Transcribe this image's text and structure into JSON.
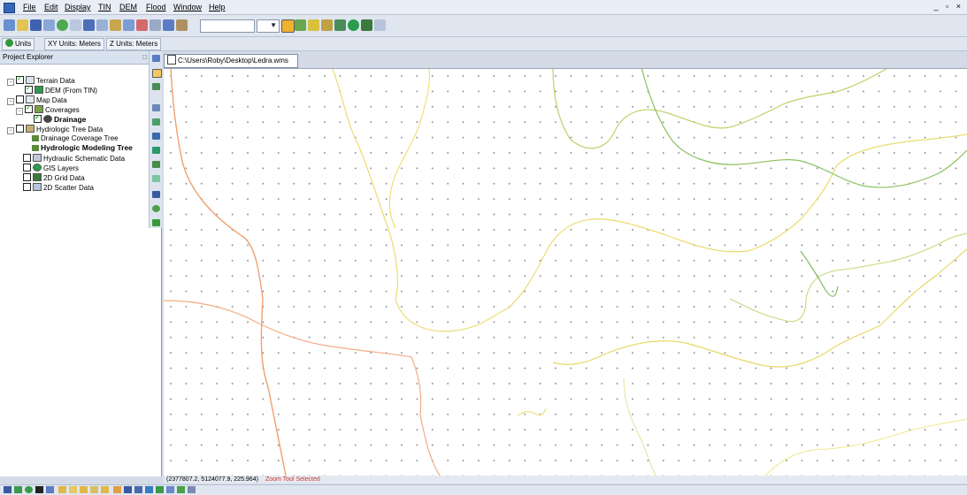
{
  "menu": {
    "items": [
      "File",
      "Edit",
      "Display",
      "TIN",
      "DEM",
      "Flood",
      "Window",
      "Help"
    ],
    "window_controls": "_ ▫ ×"
  },
  "toolbar": {
    "combo_left_value": "",
    "combo_right_value": ""
  },
  "units": {
    "tab_units": "Units",
    "tab_xy": "XY Units: Meters",
    "tab_z": "Z Units: Meters"
  },
  "explorer": {
    "title": "Project Explorer",
    "pin": "□",
    "close": "✕",
    "items": [
      {
        "label": "Terrain Data",
        "checked": true
      },
      {
        "label": "DEM (From TIN)",
        "checked": true
      },
      {
        "label": "Map Data",
        "checked": false
      },
      {
        "label": "Coverages",
        "checked": true
      },
      {
        "label": "Drainage",
        "checked": true
      },
      {
        "label": "Hydrologic Tree Data",
        "checked": false
      },
      {
        "label": "Drainage Coverage Tree",
        "checked": false
      },
      {
        "label": "Hydrologic Modeling Tree",
        "checked": false
      },
      {
        "label": "Hydraulic Schematic Data",
        "checked": false
      },
      {
        "label": "GIS Layers",
        "checked": false
      },
      {
        "label": "2D Grid Data",
        "checked": false
      },
      {
        "label": "2D Scatter Data",
        "checked": false
      }
    ]
  },
  "document": {
    "path": "C:\\Users\\Roby\\Desktop\\Ledra.wms"
  },
  "status": {
    "coords": "(2377807.2, 5124077.9, 225.964)",
    "mode": "Zoom Tool Selected"
  },
  "colors": {
    "contour_orange": "#f0a070",
    "contour_yellow": "#e8dc6a",
    "contour_lightgreen": "#b8d46a",
    "contour_green": "#8cc060",
    "grid_dot": "#7a7a7a"
  }
}
